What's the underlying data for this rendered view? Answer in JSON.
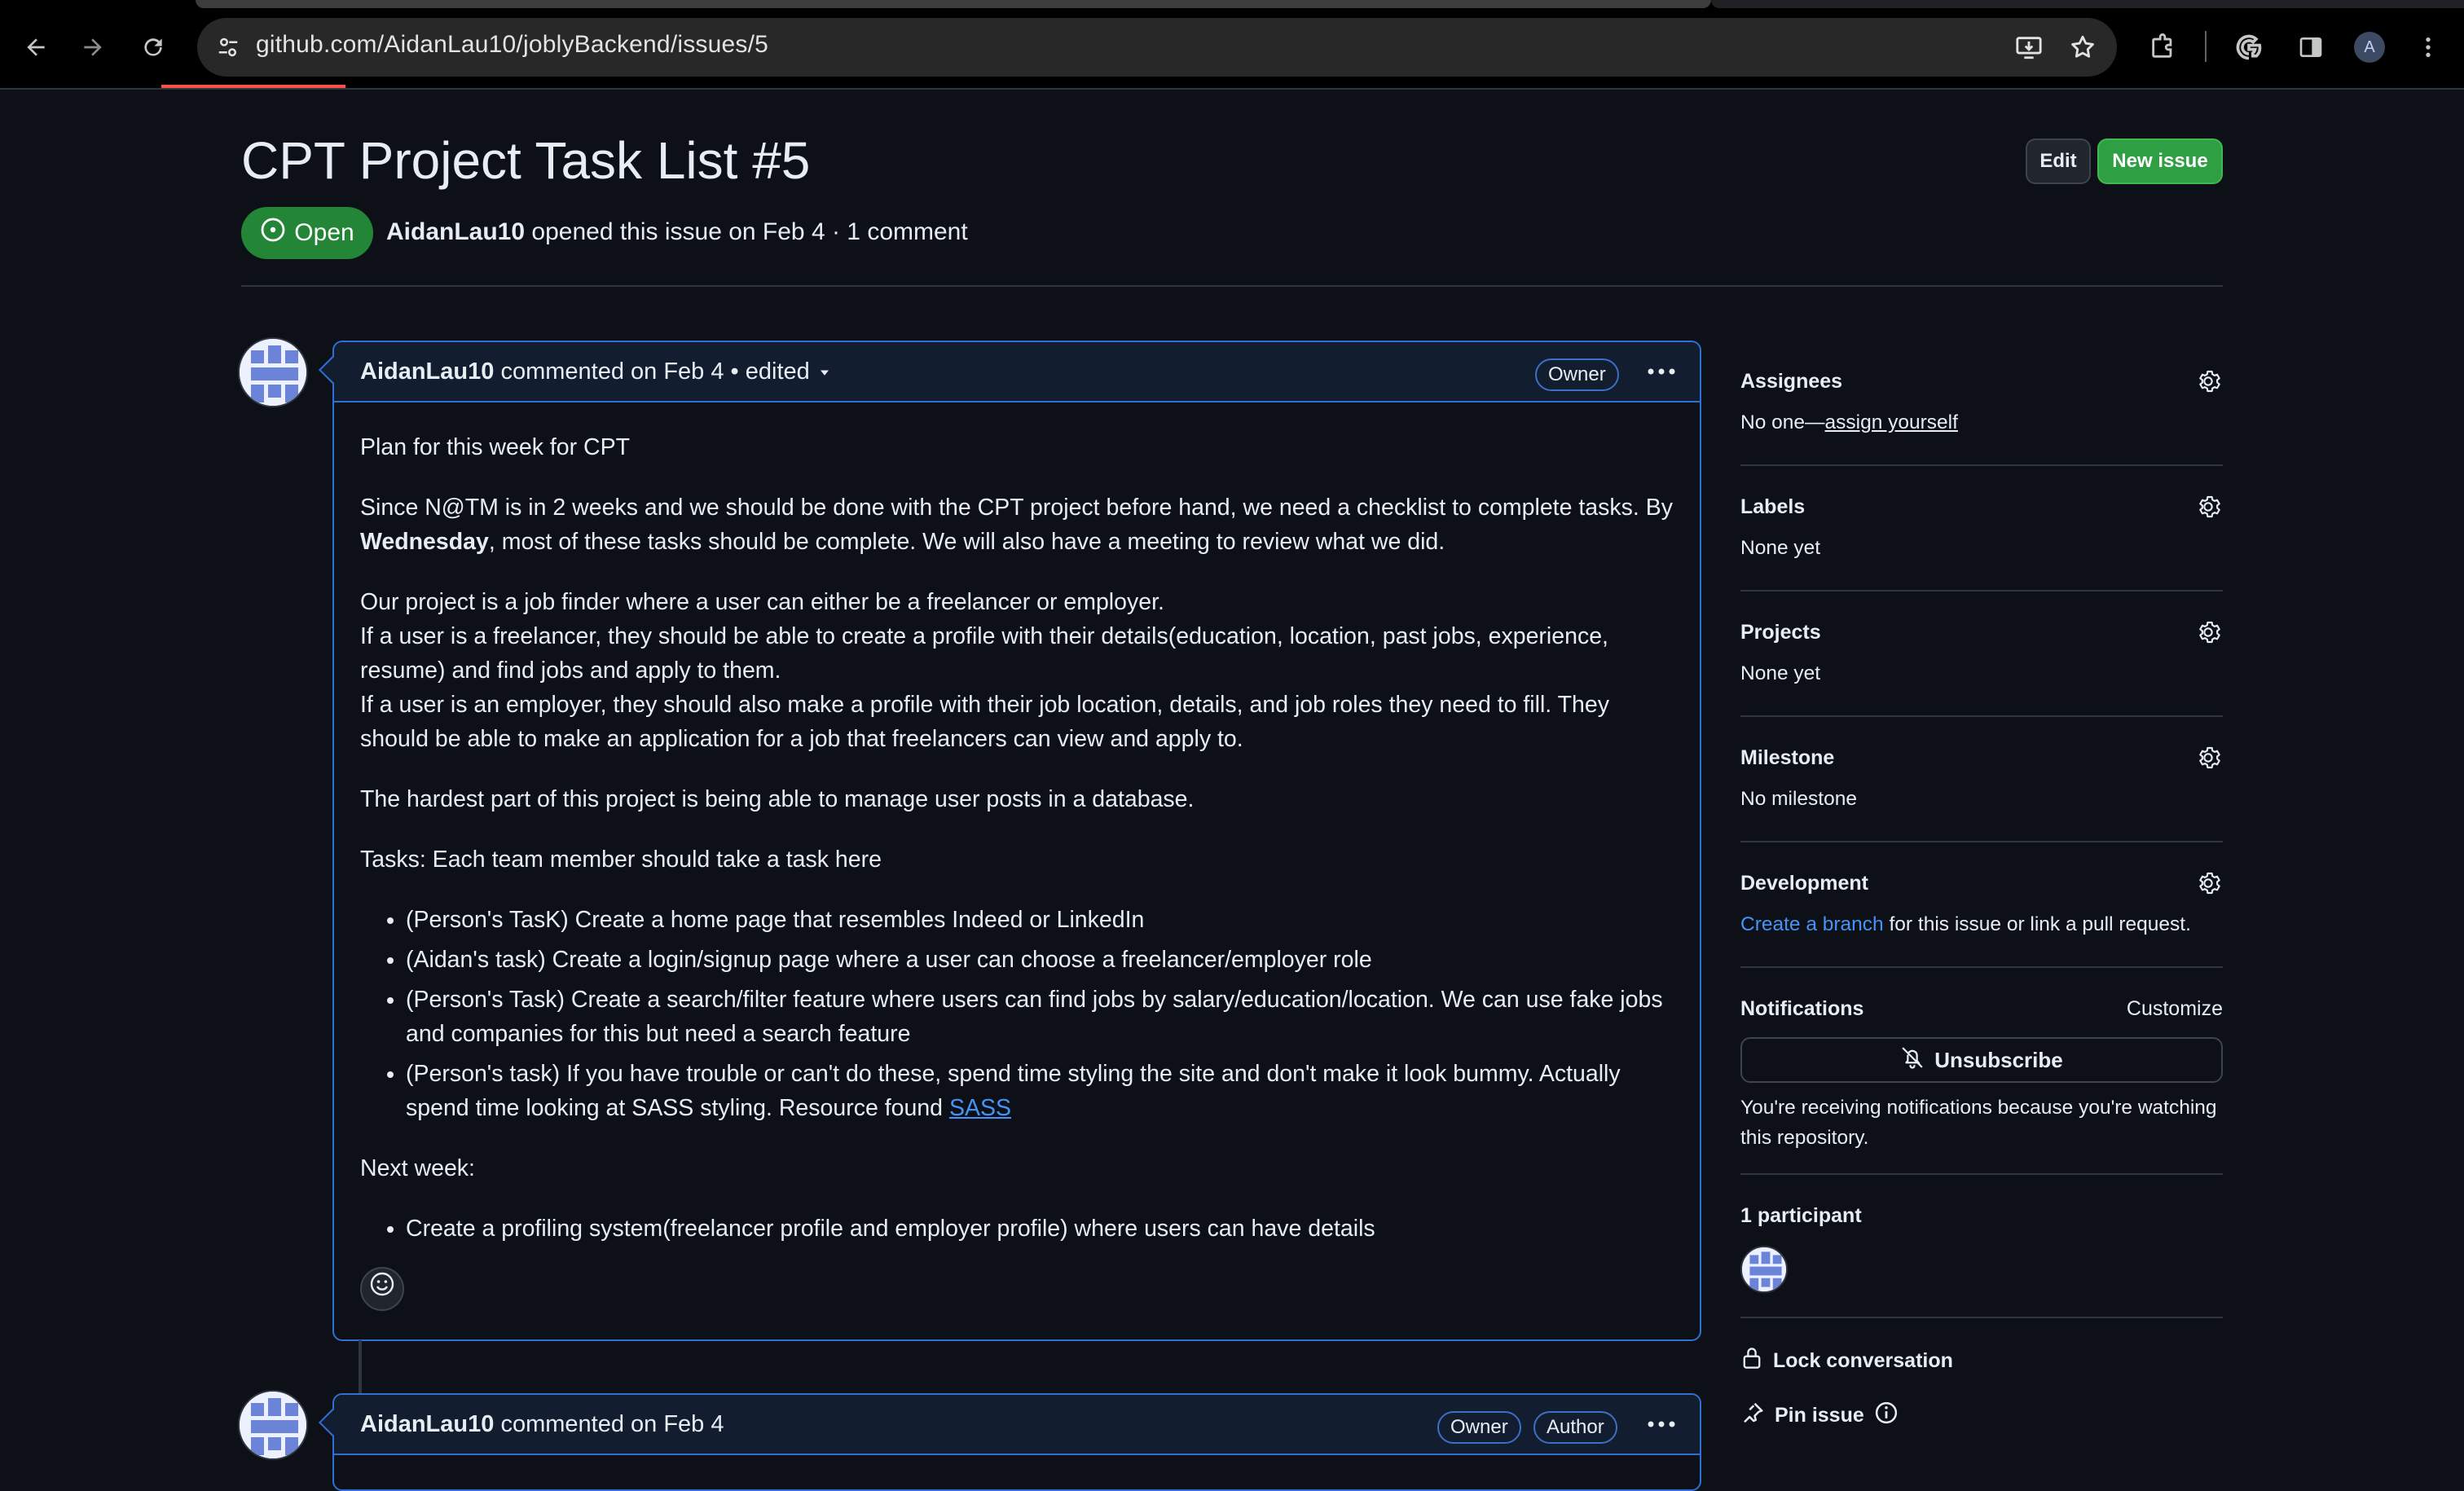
{
  "browser": {
    "url": "github.com/AidanLau10/joblyBackend/issues/5",
    "profile_initial": "A",
    "icons": [
      "back-arrow-icon",
      "forward-arrow-icon",
      "reload-icon",
      "site-settings-icon",
      "install-app-icon",
      "bookmark-star-icon",
      "extensions-icon",
      "google-icon",
      "side-panel-icon",
      "profile-avatar-icon",
      "menu-kebab-icon"
    ]
  },
  "issue": {
    "title": "CPT Project Task List #5",
    "state": "Open",
    "author": "AidanLau10",
    "meta_rest": "opened this issue on Feb 4 · 1 comment",
    "edit_label": "Edit",
    "new_issue_label": "New issue"
  },
  "comment1": {
    "author": "AidanLau10",
    "action": "commented on Feb 4",
    "edited": "• edited",
    "badge": "Owner",
    "p1": "Plan for this week for CPT",
    "p2_a": "Since N@TM is in 2 weeks and we should be done with the CPT project before hand, we need a checklist to complete tasks. By ",
    "p2_bold": "Wednesday",
    "p2_b": ", most of these tasks should be complete. We will also have a meeting to review what we did.",
    "p3_l1": "Our project is a job finder where a user can either be a freelancer or employer.",
    "p3_l2": "If a user is a freelancer, they should be able to create a profile with their details(education, location, past jobs, experience, resume) and find jobs and apply to them.",
    "p3_l3": "If a user is an employer, they should also make a profile with their job location, details, and job roles they need to fill. They should be able to make an application for a job that freelancers can view and apply to.",
    "p4": "The hardest part of this project is being able to manage user posts in a database.",
    "p5": "Tasks: Each team member should take a task here",
    "tasks": [
      "(Person's TasK) Create a home page that resembles Indeed or LinkedIn",
      "(Aidan's task) Create a login/signup page where a user can choose a freelancer/employer role",
      "(Person's Task) Create a search/filter feature where users can find jobs by salary/education/location. We can use fake jobs and companies for this but need a search feature",
      "(Person's task) If you have trouble or can't do these, spend time styling the site and don't make it look bummy. Actually spend time looking at SASS styling. Resource found "
    ],
    "task4_link": "SASS",
    "p6": "Next week:",
    "next_week": [
      "Create a profiling system(freelancer profile and employer profile) where users can have details"
    ]
  },
  "comment2": {
    "author": "AidanLau10",
    "action": "commented on Feb 4",
    "badge_owner": "Owner",
    "badge_author": "Author"
  },
  "sidebar": {
    "assignees_title": "Assignees",
    "assignees_prefix": "No one—",
    "assignees_link": "assign yourself",
    "labels_title": "Labels",
    "labels_value": "None yet",
    "projects_title": "Projects",
    "projects_value": "None yet",
    "milestone_title": "Milestone",
    "milestone_value": "No milestone",
    "development_title": "Development",
    "development_link": "Create a branch",
    "development_rest": " for this issue or link a pull request.",
    "notifications_title": "Notifications",
    "customize_label": "Customize",
    "unsubscribe_label": "Unsubscribe",
    "notifications_note": "You're receiving notifications because you're watching this repository.",
    "participants_title": "1 participant",
    "lock_label": "Lock conversation",
    "pin_label": "Pin issue"
  },
  "colors": {
    "background": "#0d1117",
    "open_green": "#238636",
    "new_issue_green": "#2ea043",
    "link_blue": "#4493f8",
    "comment_border": "#2f6fd6"
  }
}
